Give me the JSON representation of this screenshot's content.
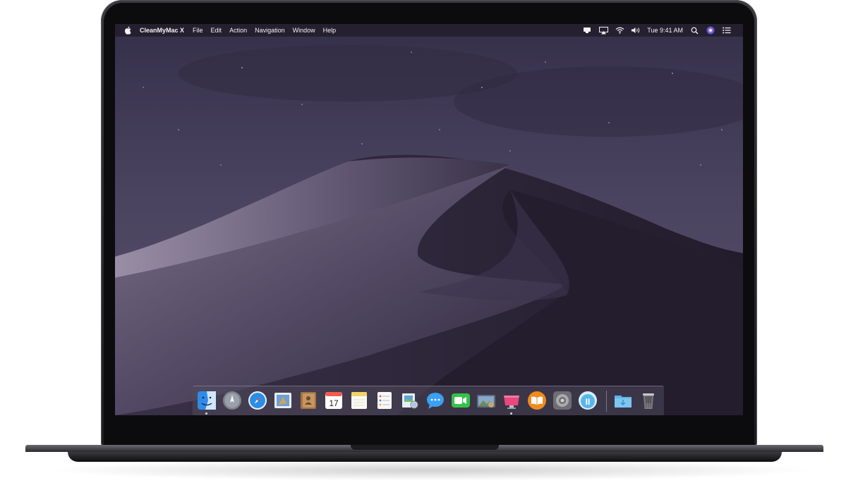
{
  "menubar": {
    "apple_icon": "apple-logo-icon",
    "app_name": "CleanMyMac X",
    "menus": [
      "File",
      "Edit",
      "Action",
      "Navigation",
      "Window",
      "Help"
    ],
    "status_icons": [
      "cleanmymac-menu-icon",
      "airplay-icon",
      "wifi-icon",
      "volume-icon"
    ],
    "clock": "Tue 9:41 AM",
    "right_icons": [
      "spotlight-search-icon",
      "siri-icon",
      "notification-center-icon"
    ]
  },
  "dock": {
    "apps": [
      {
        "name": "finder-icon",
        "color": "#3b9ef3",
        "running": true
      },
      {
        "name": "launchpad-icon",
        "color": "#8a8f98",
        "running": false
      },
      {
        "name": "safari-icon",
        "color": "#1f86e0",
        "running": false
      },
      {
        "name": "mail-icon",
        "color": "#4a90d9",
        "running": false
      },
      {
        "name": "contacts-icon",
        "color": "#a0743f",
        "running": false
      },
      {
        "name": "calendar-icon",
        "color": "#ffffff",
        "running": false,
        "text": "17"
      },
      {
        "name": "notes-icon",
        "color": "#f7e27a",
        "running": false
      },
      {
        "name": "reminders-icon",
        "color": "#f5f5f5",
        "running": false
      },
      {
        "name": "preview-icon",
        "color": "#6aa6d8",
        "running": false
      },
      {
        "name": "messages-icon",
        "color": "#3aa0f5",
        "running": false
      },
      {
        "name": "facetime-icon",
        "color": "#35c24a",
        "running": false
      },
      {
        "name": "photo-browser-icon",
        "color": "#7f96b6",
        "running": false
      },
      {
        "name": "cleanmymac-icon",
        "color": "#e8487e",
        "running": true
      },
      {
        "name": "books-icon",
        "color": "#f08a1c",
        "running": false
      },
      {
        "name": "system-preferences-icon",
        "color": "#8e8e93",
        "running": false
      },
      {
        "name": "gemini-icon",
        "color": "#59b7ec",
        "running": false
      },
      {
        "name": "downloads-folder-icon",
        "color": "#5fb4e8",
        "running": false
      },
      {
        "name": "trash-icon",
        "color": "#6b6b70",
        "running": false
      }
    ]
  }
}
